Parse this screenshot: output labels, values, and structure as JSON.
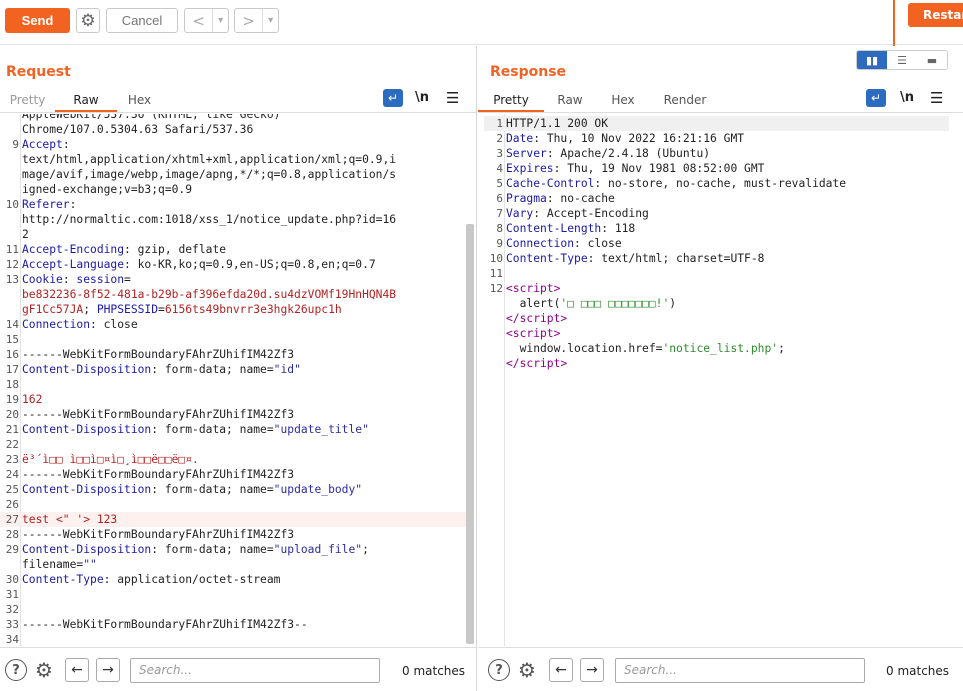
{
  "toolbar": {
    "send_label": "Send",
    "cancel_label": "Cancel",
    "restart_label": "Restar",
    "back_glyph": "<",
    "forward_glyph": ">",
    "dropdown_glyph": "▾",
    "settings_icon": "gear-icon"
  },
  "request": {
    "title": "Request",
    "tabs": [
      "Pretty",
      "Raw",
      "Hex"
    ],
    "active_tab": "Raw",
    "lines": [
      {
        "n": "",
        "html": "<span class='v'>AppleWebKit/537.36 (KHTML, like Gecko)</span>"
      },
      {
        "n": "",
        "html": "<span class='v'>Chrome/107.0.5304.63 Safari/537.36</span>"
      },
      {
        "n": "9",
        "html": "<span class='k'>Accept</span><span class='v'>:</span>"
      },
      {
        "n": "",
        "html": "<span class='v'>text/html,application/xhtml+xml,application/xml;q=0.9,i</span>"
      },
      {
        "n": "",
        "html": "<span class='v'>mage/avif,image/webp,image/apng,*/*;q=0.8,application/s</span>"
      },
      {
        "n": "",
        "html": "<span class='v'>igned-exchange;v=b3;q=0.9</span>"
      },
      {
        "n": "10",
        "html": "<span class='k'>Referer</span><span class='v'>:</span>"
      },
      {
        "n": "",
        "html": "<span class='v'>http://normaltic.com:1018/xss_1/notice_update.php?id=16</span>"
      },
      {
        "n": "",
        "html": "<span class='v'>2</span>"
      },
      {
        "n": "11",
        "html": "<span class='k'>Accept-Encoding</span><span class='v'>: gzip, deflate</span>"
      },
      {
        "n": "12",
        "html": "<span class='k'>Accept-Language</span><span class='v'>: ko-KR,ko;q=0.9,en-US;q=0.8,en;q=0.7</span>"
      },
      {
        "n": "13",
        "html": "<span class='k'>Cookie</span><span class='v'>: </span><span class='k'>session</span><span class='v'>=</span>"
      },
      {
        "n": "",
        "html": "<span class='r'>be832236-8f52-481a-b29b-af396efda20d.su4dzVOMf19HnHQN4B</span>"
      },
      {
        "n": "",
        "html": "<span class='r'>gF1Cc57JA</span><span class='v'>; </span><span class='k'>PHPSESSID</span><span class='v'>=</span><span class='r'>6156ts49bnvrr3e3hgk26upc1h</span>"
      },
      {
        "n": "14",
        "html": "<span class='k'>Connection</span><span class='v'>: close</span>"
      },
      {
        "n": "15",
        "html": ""
      },
      {
        "n": "16",
        "html": "<span class='v'>------WebKitFormBoundaryFAhrZUhifIM42Zf3</span>"
      },
      {
        "n": "17",
        "html": "<span class='k'>Content-Disposition</span><span class='v'>: form-data; name=</span><span class='s'>\"id\"</span>"
      },
      {
        "n": "18",
        "html": ""
      },
      {
        "n": "19",
        "html": "<span class='r'>162</span>"
      },
      {
        "n": "20",
        "html": "<span class='v'>------WebKitFormBoundaryFAhrZUhifIM42Zf3</span>"
      },
      {
        "n": "21",
        "html": "<span class='k'>Content-Disposition</span><span class='v'>: form-data; name=</span><span class='s'>\"update_title\"</span>"
      },
      {
        "n": "22",
        "html": ""
      },
      {
        "n": "23",
        "html": "<span class='r'>ë³´ì□□ ì□□ì□¤ì□¸ì□□ë□□ë□¤.</span>"
      },
      {
        "n": "24",
        "html": "<span class='v'>------WebKitFormBoundaryFAhrZUhifIM42Zf3</span>"
      },
      {
        "n": "25",
        "html": "<span class='k'>Content-Disposition</span><span class='v'>: form-data; name=</span><span class='s'>\"update_body\"</span>"
      },
      {
        "n": "26",
        "html": ""
      },
      {
        "n": "27",
        "html": "<span class='r'>test &lt;\" '&gt; 123</span>",
        "current": true
      },
      {
        "n": "28",
        "html": "<span class='v'>------WebKitFormBoundaryFAhrZUhifIM42Zf3</span>"
      },
      {
        "n": "29",
        "html": "<span class='k'>Content-Disposition</span><span class='v'>: form-data; name=</span><span class='s'>\"upload_file\"</span><span class='v'>;</span>"
      },
      {
        "n": "",
        "html": "<span class='v'>filename=</span><span class='s'>\"\"</span>"
      },
      {
        "n": "30",
        "html": "<span class='k'>Content-Type</span><span class='v'>: application/octet-stream</span>"
      },
      {
        "n": "31",
        "html": ""
      },
      {
        "n": "32",
        "html": ""
      },
      {
        "n": "33",
        "html": "<span class='v'>------WebKitFormBoundaryFAhrZUhifIM42Zf3--</span>"
      },
      {
        "n": "34",
        "html": ""
      }
    ],
    "search_placeholder": "Search...",
    "matches": "0 matches"
  },
  "response": {
    "title": "Response",
    "tabs": [
      "Pretty",
      "Raw",
      "Hex",
      "Render"
    ],
    "active_tab": "Pretty",
    "lines": [
      {
        "n": "1",
        "html": "<span class='v'>HTTP/1.1 200 OK</span>",
        "hl": true
      },
      {
        "n": "2",
        "html": "<span class='k'>Date</span><span class='v'>: Thu, 10 Nov 2022 16:21:16 GMT</span>"
      },
      {
        "n": "3",
        "html": "<span class='k'>Server</span><span class='v'>: Apache/2.4.18 (Ubuntu)</span>"
      },
      {
        "n": "4",
        "html": "<span class='k'>Expires</span><span class='v'>: Thu, 19 Nov 1981 08:52:00 GMT</span>"
      },
      {
        "n": "5",
        "html": "<span class='k'>Cache-Control</span><span class='v'>: no-store, no-cache, must-revalidate</span>"
      },
      {
        "n": "6",
        "html": "<span class='k'>Pragma</span><span class='v'>: no-cache</span>"
      },
      {
        "n": "7",
        "html": "<span class='k'>Vary</span><span class='v'>: Accept-Encoding</span>"
      },
      {
        "n": "8",
        "html": "<span class='k'>Content-Length</span><span class='v'>: 118</span>"
      },
      {
        "n": "9",
        "html": "<span class='k'>Connection</span><span class='v'>: close</span>"
      },
      {
        "n": "10",
        "html": "<span class='k'>Content-Type</span><span class='v'>: text/html; charset=UTF-8</span>"
      },
      {
        "n": "11",
        "html": ""
      },
      {
        "n": "12",
        "html": "<span class='t'>&lt;script&gt;</span>"
      },
      {
        "n": "",
        "html": "<span class='v'>  alert(</span><span class='g'>'□ □□□ □□□□□□□!'</span><span class='v'>)</span>"
      },
      {
        "n": "",
        "html": "<span class='t'>&lt;/script&gt;</span>"
      },
      {
        "n": "",
        "html": "<span class='t'>&lt;script&gt;</span>"
      },
      {
        "n": "",
        "html": "<span class='v'>  window.location.href=</span><span class='g'>'notice_list.php'</span><span class='v'>;</span>"
      },
      {
        "n": "",
        "html": "<span class='t'>&lt;/script&gt;</span>"
      }
    ],
    "search_placeholder": "Search...",
    "matches": "0 matches"
  },
  "icons": {
    "wrap": "↵",
    "newline": "\\n",
    "menu": "☰",
    "help": "?",
    "gear": "⚙",
    "left": "←",
    "right": "→"
  }
}
